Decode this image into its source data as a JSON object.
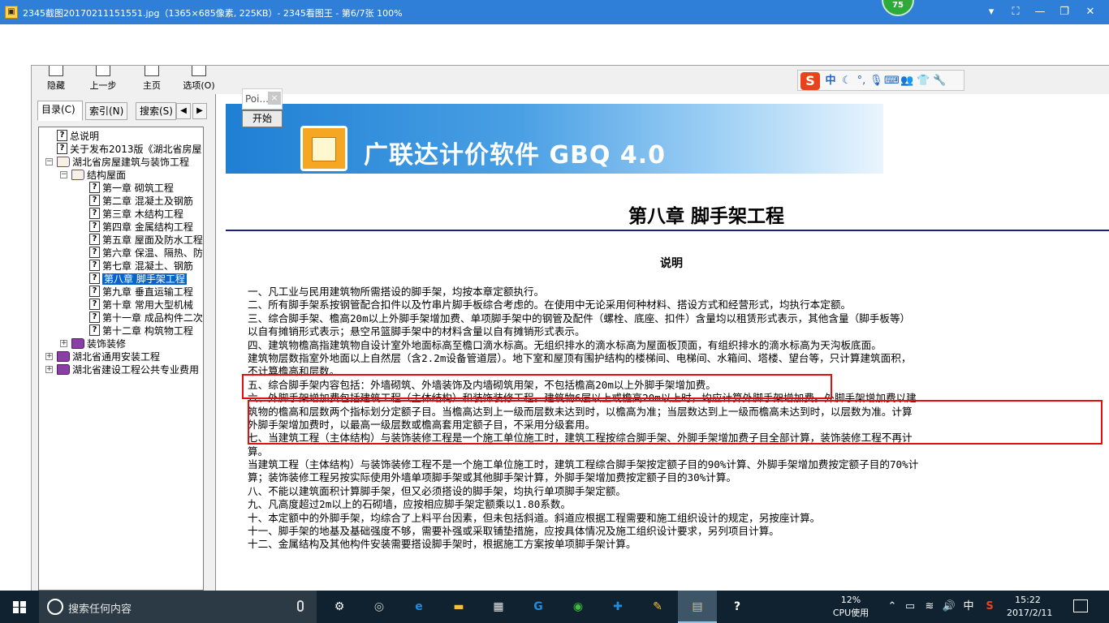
{
  "viewer": {
    "title": "2345截图20170211151551.jpg（1365×685像素, 225KB）- 2345看图王 - 第6/7张 100%",
    "badge": "75"
  },
  "chm": {
    "toolbar": {
      "hide": "隐藏",
      "back": "上一步",
      "home": "主页",
      "options": "选项(O)"
    },
    "nav_tabs": [
      "目录(C)",
      "索引(N)",
      "搜索(S)"
    ],
    "toc": [
      {
        "label": "总说明",
        "type": "page",
        "depth": 1
      },
      {
        "label": "关于发布2013版《湖北省房屋",
        "type": "page",
        "depth": 1
      },
      {
        "label": "湖北省房屋建筑与装饰工程",
        "type": "book-open",
        "depth": 0,
        "expander": "−"
      },
      {
        "label": "结构屋面",
        "type": "book-open",
        "depth": 1,
        "expander": "−"
      },
      {
        "label": "第一章 砌筑工程",
        "type": "page",
        "depth": 3
      },
      {
        "label": "第二章 混凝土及钢筋",
        "type": "page",
        "depth": 3
      },
      {
        "label": "第三章 木结构工程",
        "type": "page",
        "depth": 3
      },
      {
        "label": "第四章 金属结构工程",
        "type": "page",
        "depth": 3
      },
      {
        "label": "第五章 屋面及防水工程",
        "type": "page",
        "depth": 3
      },
      {
        "label": "第六章 保温、隔热、防",
        "type": "page",
        "depth": 3
      },
      {
        "label": "第七章 混凝土、钢筋",
        "type": "page",
        "depth": 3
      },
      {
        "label": "第八章 脚手架工程",
        "type": "page",
        "depth": 3,
        "selected": true
      },
      {
        "label": "第九章 垂直运输工程",
        "type": "page",
        "depth": 3
      },
      {
        "label": "第十章 常用大型机械",
        "type": "page",
        "depth": 3
      },
      {
        "label": "第十一章 成品构件二次",
        "type": "page",
        "depth": 3
      },
      {
        "label": "第十二章 构筑物工程",
        "type": "page",
        "depth": 3
      },
      {
        "label": "装饰装修",
        "type": "book",
        "depth": 1,
        "expander": "+"
      },
      {
        "label": "湖北省通用安装工程",
        "type": "book",
        "depth": 0,
        "expander": "+"
      },
      {
        "label": "湖北省建设工程公共专业费用",
        "type": "book",
        "depth": 0,
        "expander": "+"
      }
    ],
    "popup": {
      "title": "Poi...",
      "close": "×",
      "start": "开始"
    },
    "banner_title": "广联达计价软件 GBQ 4.0",
    "chapter_title": "第八章 脚手架工程",
    "section_heading": "说明",
    "body_lines": [
      "一、凡工业与民用建筑物所需搭设的脚手架，均按本章定额执行。",
      "二、所有脚手架系按钢管配合扣件以及竹串片脚手板综合考虑的。在使用中无论采用何种材料、搭设方式和经营形式，均执行本定额。",
      "三、综合脚手架、檐高20m以上外脚手架增加费、单项脚手架中的钢管及配件（螺栓、底座、扣件）含量均以租赁形式表示，其他含量（脚手板等）",
      "以自有摊销形式表示；悬空吊篮脚手架中的材料含量以自有摊销形式表示。",
      "四、建筑物檐高指建筑物自设计室外地面标高至檐口滴水标高。无组织排水的滴水标高为屋面板顶面，有组织排水的滴水标高为天沟板底面。",
      "建筑物层数指室外地面以上自然层（含2.2m设备管道层）。地下室和屋顶有围护结构的楼梯间、电梯间、水箱间、塔楼、望台等，只计算建筑面积，",
      "不计算檐高和层数。",
      "五、综合脚手架内容包括：外墙砌筑、外墙装饰及内墙砌筑用架，不包括檐高20m以上外脚手架增加费。",
      "六、外脚手架增加费包括建筑工程（主体结构）和装饰装修工程。建筑物6层以上或檐高20m以上时，均应计算外脚手架增加费。外脚手架增加费以建",
      "筑物的檐高和层数两个指标划分定额子目。当檐高达到上一级而层数未达到时，以檐高为准；当层数达到上一级而檐高未达到时，以层数为准。计算",
      "外脚手架增加费时，以最高一级层数或檐高套用定额子目，不采用分级套用。",
      "七、当建筑工程（主体结构）与装饰装修工程是一个施工单位施工时，建筑工程按综合脚手架、外脚手架增加费子目全部计算，装饰装修工程不再计",
      "算。",
      "当建筑工程（主体结构）与装饰装修工程不是一个施工单位施工时，建筑工程综合脚手架按定额子目的90%计算、外脚手架增加费按定额子目的70%计",
      "算；装饰装修工程另按实际使用外墙单项脚手架或其他脚手架计算，外脚手架增加费按定额子目的30%计算。",
      "八、不能以建筑面积计算脚手架，但又必须搭设的脚手架，均执行单项脚手架定额。",
      "九、凡高度超过2m以上的石砌墙，应按相应脚手架定额乘以1.80系数。",
      "十、本定额中的外脚手架，均综合了上料平台因素，但未包括斜道。斜道应根据工程需要和施工组织设计的规定，另按座计算。",
      "十一、脚手架的地基及基础强度不够，需要补强或采取铺垫措施，应按具体情况及施工组织设计要求，另列项目计算。",
      "十二、金属结构及其他构件安装需要搭设脚手架时，根据施工方案按单项脚手架计算。"
    ]
  },
  "ime": {
    "logo": "S",
    "mode": "中"
  },
  "taskbar": {
    "search_placeholder": "搜索任何内容",
    "cpu_percent": "12%",
    "cpu_label": "CPU使用",
    "ime_indicator": "中",
    "time": "15:22",
    "date": "2017/2/11"
  },
  "colors": {
    "viewer_titlebar": "#2f7fd8",
    "highlight": "#e01010",
    "chapter_rule": "#1c1c8c",
    "toc_selected": "#0a64c8",
    "taskbar": "#10222f"
  },
  "icons": {
    "taskbar_apps": [
      "task-view-icon",
      "app-swirl-icon",
      "edge-icon",
      "file-explorer-icon",
      "store-icon",
      "2345-browser-icon",
      "green-app-icon",
      "blue-app-icon",
      "notepad-icon",
      "2345-viewer-icon",
      "help-file-icon"
    ]
  }
}
